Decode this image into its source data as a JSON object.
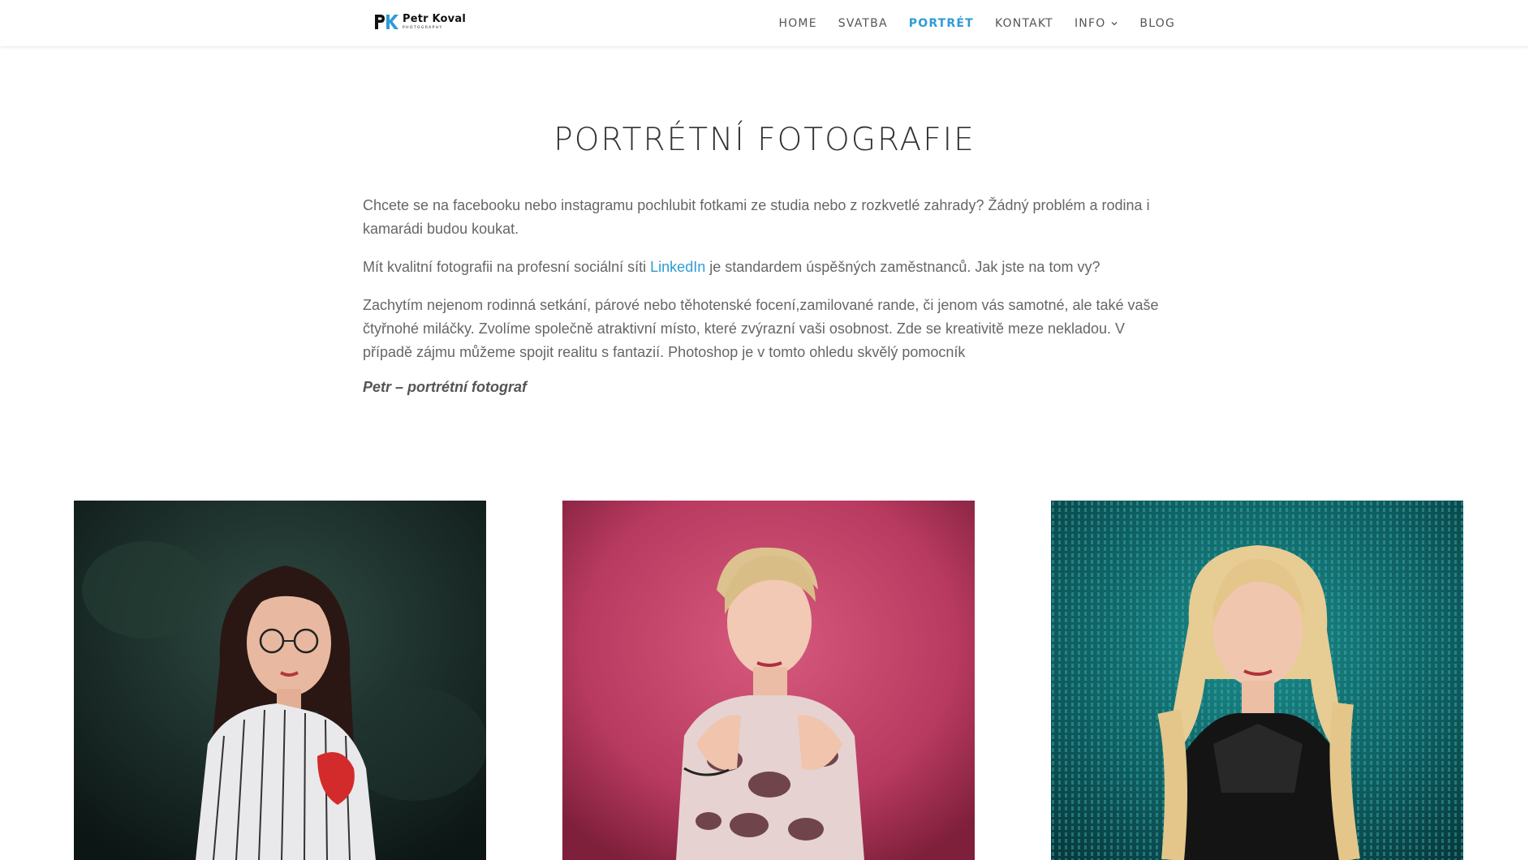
{
  "header": {
    "logo": {
      "name": "Petr Koval",
      "sub": "PHOTOGRAPHY"
    },
    "nav": [
      {
        "label": "HOME"
      },
      {
        "label": "SVATBA"
      },
      {
        "label": "PORTRÉT",
        "active": true
      },
      {
        "label": "KONTAKT"
      },
      {
        "label": "INFO",
        "has_dropdown": true
      },
      {
        "label": "BLOG"
      }
    ]
  },
  "main": {
    "title": "PORTRÉTNÍ FOTOGRAFIE",
    "p1": "Chcete se na facebooku nebo instagramu pochlubit fotkami ze studia nebo z rozkvetlé zahrady? Žádný problém a rodina i kamarádi budou koukat.",
    "p2": {
      "before": "Mít kvalitní fotografii na profesní sociální síti ",
      "link": "LinkedIn",
      "after": " je standardem úspěšných zaměstnanců. Jak jste na tom vy?"
    },
    "p3": "Zachytím nejenom rodinná setkání, párové nebo těhotenské focení,zamilované rande, či jenom vás samotné, ale také vaše čtyřnohé miláčky. Zvolíme společně atraktivní místo, které zvýrazní vaši osobnost. Zde se kreativitě meze nekladou. V případě zájmu můžeme spojit realitu s fantazií. Photoshop je v tomto ohledu skvělý pomocník",
    "signature": "Petr – portrétní fotograf"
  },
  "gallery": [
    {
      "icon": "portrait-photo-dark-green-background"
    },
    {
      "icon": "portrait-photo-pink-background"
    },
    {
      "icon": "portrait-photo-teal-background"
    }
  ],
  "colors": {
    "accent": "#2e9bd6",
    "nav_text": "#555555",
    "title": "#333333",
    "body_text": "#666666"
  }
}
